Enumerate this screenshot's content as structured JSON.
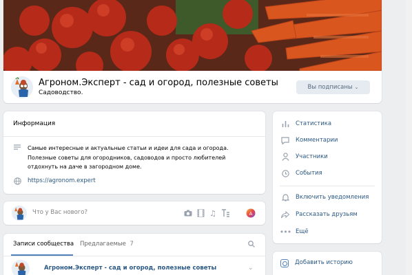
{
  "header": {
    "group_name": "Агроном.Эксперт - сад и огород, полезные советы",
    "category": "Садоводство.",
    "subscribe_button": "Вы подписаны",
    "cover_image": "vegetables-cover"
  },
  "info": {
    "heading": "Информация",
    "description": "Самые интересные и актуальные статьи и идеи для сада и огорода. Полезные советы для огородников, садоводов и просто любителей отдохнуть на даче в загородном доме.",
    "website": "https://agronom.expert"
  },
  "composer": {
    "placeholder": "Что у Вас нового?",
    "icons": [
      "camera-icon",
      "film-icon",
      "music-icon",
      "text-format-icon",
      "poster-icon"
    ]
  },
  "wall": {
    "tabs": [
      {
        "label": "Записи сообщества"
      },
      {
        "label": "Предлагаемые",
        "count": "7"
      }
    ],
    "post_author": "Агроном.Эксперт - сад и огород, полезные советы"
  },
  "menu": {
    "items": [
      {
        "label": "Статистика",
        "icon": "stats-icon"
      },
      {
        "label": "Комментарии",
        "icon": "comment-icon"
      },
      {
        "label": "Участники",
        "icon": "members-icon"
      },
      {
        "label": "События",
        "icon": "events-icon"
      },
      {
        "label": "Включить уведомления",
        "icon": "bell-icon"
      },
      {
        "label": "Рассказать друзьям",
        "icon": "share-icon"
      },
      {
        "label": "Ещё",
        "icon": "more-icon"
      }
    ]
  },
  "stories": {
    "add_label": "Добавить историю"
  },
  "colors": {
    "link": "#2a5885",
    "accent": "#5181b8",
    "background": "#edeef0"
  }
}
